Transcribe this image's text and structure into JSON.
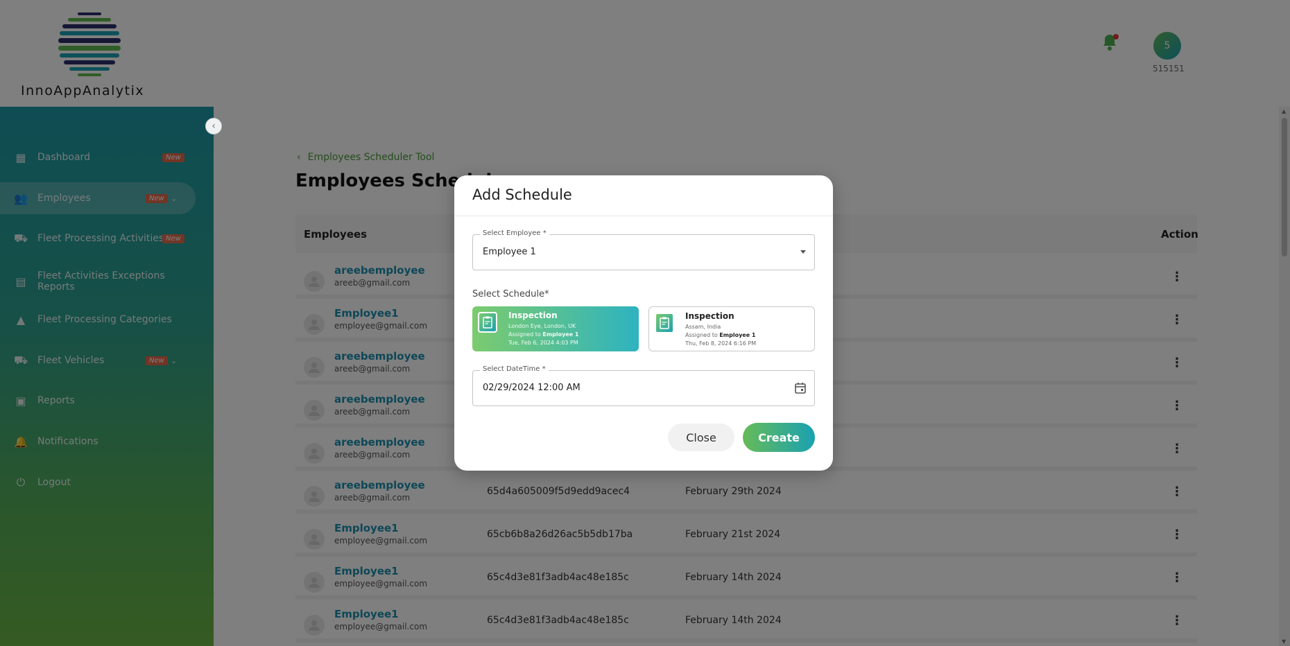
{
  "app": {
    "brand": "InnoAppAnalytix",
    "avatar_initial": "5",
    "user_id": "515151"
  },
  "sidebar": {
    "items": [
      {
        "label": "Dashboard",
        "badge": "New"
      },
      {
        "label": "Employees",
        "badge": "New"
      },
      {
        "label": "Fleet Processing Activities",
        "badge": "New"
      },
      {
        "label": "Fleet Activities Exceptions Reports",
        "badge": ""
      },
      {
        "label": "Fleet Processing Categories",
        "badge": ""
      },
      {
        "label": "Fleet Vehicles",
        "badge": "New"
      },
      {
        "label": "Reports",
        "badge": ""
      },
      {
        "label": "Notifications",
        "badge": ""
      },
      {
        "label": "Logout",
        "badge": ""
      }
    ]
  },
  "main": {
    "breadcrumb": "Employees Scheduler Tool",
    "title": "Employees Schedul",
    "table": {
      "headers": {
        "employees": "Employees",
        "action": "Action"
      },
      "rows": [
        {
          "name": "areebemployee",
          "email": "areeb@gmail.com",
          "id": "",
          "date": ""
        },
        {
          "name": "Employee1",
          "email": "employee@gmail.com",
          "id": "",
          "date": ""
        },
        {
          "name": "areebemployee",
          "email": "areeb@gmail.com",
          "id": "",
          "date": ""
        },
        {
          "name": "areebemployee",
          "email": "areeb@gmail.com",
          "id": "",
          "date": ""
        },
        {
          "name": "areebemployee",
          "email": "areeb@gmail.com",
          "id": "",
          "date": ""
        },
        {
          "name": "areebemployee",
          "email": "areeb@gmail.com",
          "id": "65d4a605009f5d9edd9acec4",
          "date": "February 29th 2024"
        },
        {
          "name": "Employee1",
          "email": "employee@gmail.com",
          "id": "65cb6b8a26d26ac5b5db17ba",
          "date": "February 21st 2024"
        },
        {
          "name": "Employee1",
          "email": "employee@gmail.com",
          "id": "65c4d3e81f3adb4ac48e185c",
          "date": "February 14th 2024"
        },
        {
          "name": "Employee1",
          "email": "employee@gmail.com",
          "id": "65c4d3e81f3adb4ac48e185c",
          "date": "February 14th 2024"
        }
      ]
    }
  },
  "modal": {
    "title": "Add Schedule",
    "employee_field": {
      "label": "Select Employee",
      "required": " *",
      "value": "Employee 1"
    },
    "schedule_label": "Select Schedule*",
    "schedules": [
      {
        "title": "Inspection",
        "location": "London Eye, London, UK",
        "assigned_prefix": "Assigned to ",
        "assigned": "Employee 1",
        "time": "Tue, Feb 6, 2024 4:03 PM"
      },
      {
        "title": "Inspection",
        "location": "Assam, India",
        "assigned_prefix": "Assigned to ",
        "assigned": "Employee 1",
        "time": "Thu, Feb 8, 2024 6:16 PM"
      }
    ],
    "datetime_field": {
      "label": "Select DateTime",
      "required": " *",
      "value": "02/29/2024 12:00 AM"
    },
    "close_label": "Close",
    "create_label": "Create"
  },
  "colors": {
    "brand_gradient_start": "#66bb57",
    "brand_gradient_end": "#1aa1b2",
    "link": "#1b8fae",
    "badge": "#e46a4a"
  },
  "icons": {
    "bell": "bell-icon",
    "calendar": "calendar-icon",
    "chevron": "chevron-down-icon",
    "more": "more-vertical-icon"
  }
}
